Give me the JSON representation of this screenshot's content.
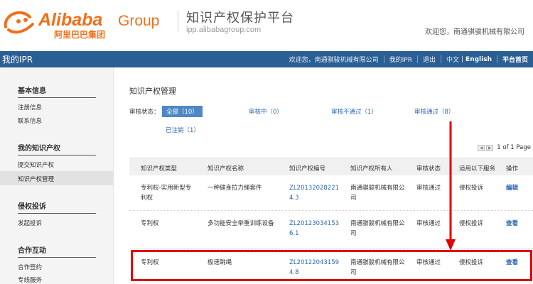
{
  "header": {
    "logo_text": "Alibaba",
    "logo_group": "Group",
    "logo_chinese": "阿里巴巴集团",
    "platform_title": "知识产权保护平台",
    "platform_url": "ipp.alibabagroup.com",
    "welcome": "欢迎您，南通骐骏机械有限公司"
  },
  "topbar": {
    "title": "我的IPR",
    "welcome": "欢迎您，南通骐骏机械有限公司",
    "my_ipr": "我的IPR",
    "logout": "退出",
    "lang_cn": "中文",
    "lang_sep": "|",
    "lang_en": "English",
    "home": "平台首页"
  },
  "sidebar": {
    "sections": [
      {
        "heading": "基本信息",
        "items": [
          "注册信息",
          "联系信息"
        ]
      },
      {
        "heading": "我的知识产权",
        "items": [
          "提交知识产权",
          "知识产权管理"
        ]
      },
      {
        "heading": "侵权投诉",
        "items": [
          "发起投诉"
        ]
      },
      {
        "heading": "合作互动",
        "items": [
          "合作签约",
          "专线服务"
        ]
      }
    ],
    "active_item": "知识产权管理"
  },
  "main": {
    "heading": "知识产权管理",
    "filter_label": "审核状态：",
    "filters": {
      "all": "全部（10）",
      "reviewing": "审核中（0）",
      "rejected": "审核不通过（1）",
      "approved": "审核通过（8）",
      "cancelled": "已注销（1）"
    },
    "pager": {
      "text": "1 of 1 Page"
    },
    "table": {
      "headers": [
        "知识产权类型",
        "知识产权名称",
        "知识产权编号",
        "知识产权所有人",
        "审核状态",
        "适用以下服务",
        "操作"
      ],
      "rows": [
        {
          "type_line1": "专利权-实用新型专",
          "type_line2": "利权",
          "name": "一种健身拉力绳套件",
          "number_line1": "ZL20132028221",
          "number_line2": "4.3",
          "owner_line1": "南通骐骏机械有限公",
          "owner_line2": "司",
          "status": "审核通过",
          "service": "侵权投诉",
          "action": "编辑"
        },
        {
          "type_line1": "专利权",
          "type_line2": "",
          "name": "多功能安全举重训练设备",
          "number_line1": "ZL20123034153",
          "number_line2": "6.1",
          "owner_line1": "南通骐骏机械有限公",
          "owner_line2": "司",
          "status": "审核通过",
          "service": "侵权投诉",
          "action": "查看"
        },
        {
          "type_line1": "专利权",
          "type_line2": "",
          "name": "极速跳绳",
          "number_line1": "ZL20122043159",
          "number_line2": "4.8",
          "owner_line1": "南通骐骏机械有限公",
          "owner_line2": "司",
          "status": "审核通过",
          "service": "侵权投诉",
          "action": "查看"
        }
      ]
    }
  },
  "colors": {
    "brand_orange": "#f06f1a",
    "topbar_blue": "#2b5f93",
    "link_blue": "#2a66b0",
    "annotation_red": "#e10000"
  },
  "icons": {
    "logo": "alibaba-smile-logo",
    "pager_prev": "pager-prev-icon",
    "pager_next": "pager-next-icon",
    "annotation": "red-arrow-icon"
  }
}
